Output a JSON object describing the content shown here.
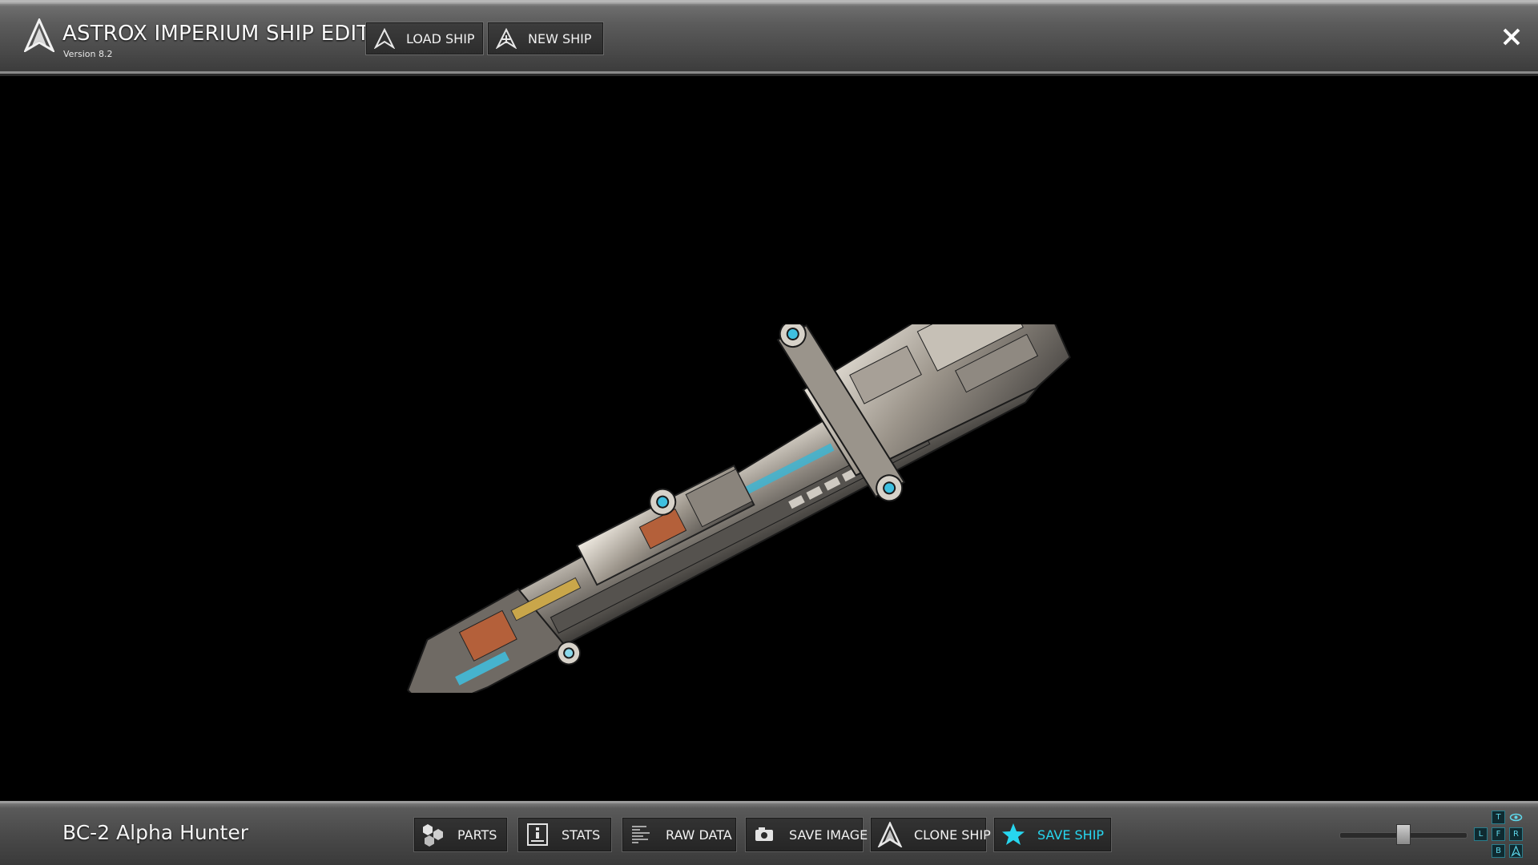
{
  "app": {
    "title": "ASTROX IMPERIUM SHIP EDITOR",
    "version": "Version 8.2",
    "logo_icon": "astrox-logo-icon",
    "close_icon": "close-icon"
  },
  "toolbar": {
    "load_ship": "LOAD SHIP",
    "new_ship": "NEW SHIP"
  },
  "ship": {
    "name": "BC-2 Alpha Hunter"
  },
  "actions": {
    "parts": "PARTS",
    "stats": "STATS",
    "raw_data": "RAW DATA",
    "save_image": "SAVE IMAGE",
    "clone_ship": "CLONE SHIP",
    "save_ship": "SAVE SHIP"
  },
  "view": {
    "zoom_level": 0.5,
    "top": "T",
    "left": "L",
    "front": "F",
    "right": "R",
    "bottom": "B"
  },
  "colors": {
    "accent": "#27d6ef",
    "bar": "#4a4a4a"
  }
}
